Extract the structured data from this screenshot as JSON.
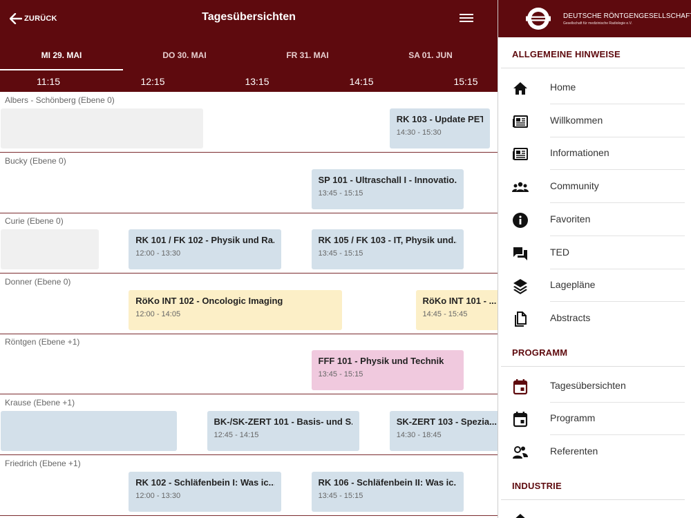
{
  "header": {
    "back_label": "ZURÜCK",
    "title": "Tagesübersichten"
  },
  "day_tabs": [
    {
      "label": "MI 29. MAI",
      "active": true
    },
    {
      "label": "DO 30. MAI",
      "active": false
    },
    {
      "label": "FR 31. MAI",
      "active": false
    },
    {
      "label": "SA 01. JUN",
      "active": false
    }
  ],
  "time_axis": [
    "11:15",
    "12:15",
    "13:15",
    "14:15",
    "15:15"
  ],
  "colors": {
    "brand": "#5e0a0e",
    "session_blue": "#d3e0ea",
    "session_yellow": "#fcefc7",
    "session_pink": "#f0c9de",
    "session_gray": "#f0f0f0"
  },
  "rooms": [
    {
      "name": "Albers - Schönberg (Ebene 0)",
      "sessions": [
        {
          "title": "",
          "time": "",
          "start": "10:45",
          "end": "12:45",
          "color": "session_gray"
        },
        {
          "title": "RK 103 - Update PET...",
          "time": "14:30 - 15:30",
          "start": "14:30",
          "end": "15:30",
          "color": "session_blue"
        }
      ]
    },
    {
      "name": "Bucky (Ebene 0)",
      "sessions": [
        {
          "title": "SP 101 - Ultraschall I - Innovatio...",
          "time": "13:45 - 15:15",
          "start": "13:45",
          "end": "15:15",
          "color": "session_blue"
        }
      ]
    },
    {
      "name": "Curie (Ebene 0)",
      "sessions": [
        {
          "title": "",
          "time": "",
          "start": "10:45",
          "end": "11:45",
          "color": "session_gray"
        },
        {
          "title": "RK 101 / FK 102 - Physik und Ra...",
          "time": "12:00 - 13:30",
          "start": "12:00",
          "end": "13:30",
          "color": "session_blue"
        },
        {
          "title": "RK 105 / FK 103 - IT, Physik und...",
          "time": "13:45 - 15:15",
          "start": "13:45",
          "end": "15:15",
          "color": "session_blue"
        }
      ]
    },
    {
      "name": "Donner (Ebene 0)",
      "sessions": [
        {
          "title": "RöKo INT 102 - Oncologic Imaging",
          "time": "12:00 - 14:05",
          "start": "12:00",
          "end": "14:05",
          "color": "session_yellow"
        },
        {
          "title": "RöKo INT 101 - ...",
          "time": "14:45 - 15:45",
          "start": "14:45",
          "end": "15:45",
          "color": "session_yellow"
        }
      ]
    },
    {
      "name": "Röntgen (Ebene +1)",
      "sessions": [
        {
          "title": "FFF 101 - Physik und Technik",
          "time": "13:45 - 15:15",
          "start": "13:45",
          "end": "15:15",
          "color": "session_pink"
        }
      ]
    },
    {
      "name": "Krause (Ebene +1)",
      "sessions": [
        {
          "title": "",
          "time": "",
          "start": "10:45",
          "end": "12:30",
          "color": "session_blue"
        },
        {
          "title": "BK-/SK-ZERT 101 - Basis- und S...",
          "time": "12:45 - 14:15",
          "start": "12:45",
          "end": "14:15",
          "color": "session_blue"
        },
        {
          "title": "SK-ZERT 103 - Spezia...",
          "time": "14:30 - 18:45",
          "start": "14:30",
          "end": "18:45",
          "color": "session_blue"
        }
      ]
    },
    {
      "name": "Friedrich (Ebene +1)",
      "sessions": [
        {
          "title": "RK 102 - Schläfenbein I: Was ic...",
          "time": "12:00 - 13:30",
          "start": "12:00",
          "end": "13:30",
          "color": "session_blue"
        },
        {
          "title": "RK 106 - Schläfenbein II: Was ic...",
          "time": "13:45 - 15:15",
          "start": "13:45",
          "end": "15:15",
          "color": "session_blue"
        }
      ]
    }
  ],
  "drawer": {
    "org_name": "DEUTSCHE RÖNTGENGESELLSCHAFT",
    "org_subtitle": "Gesellschaft für medizinische Radiologie e.V.",
    "sections": [
      {
        "title": "ALLGEMEINE HINWEISE",
        "items": [
          {
            "label": "Home",
            "icon": "home-icon"
          },
          {
            "label": "Willkommen",
            "icon": "newspaper-icon"
          },
          {
            "label": "Informationen",
            "icon": "newspaper-icon"
          },
          {
            "label": "Community",
            "icon": "group-icon"
          },
          {
            "label": "Favoriten",
            "icon": "info-icon"
          },
          {
            "label": "TED",
            "icon": "chat-icon"
          },
          {
            "label": "Lagepläne",
            "icon": "layers-icon"
          },
          {
            "label": "Abstracts",
            "icon": "document-icon"
          }
        ]
      },
      {
        "title": "PROGRAMM",
        "items": [
          {
            "label": "Tagesübersichten",
            "icon": "calendar-icon",
            "accent": true
          },
          {
            "label": "Programm",
            "icon": "calendar-icon",
            "accent": false
          },
          {
            "label": "Referenten",
            "icon": "speakers-icon",
            "accent": false
          }
        ]
      },
      {
        "title": "INDUSTRIE",
        "items": [
          {
            "label": "",
            "icon": "home-icon"
          }
        ]
      }
    ]
  }
}
